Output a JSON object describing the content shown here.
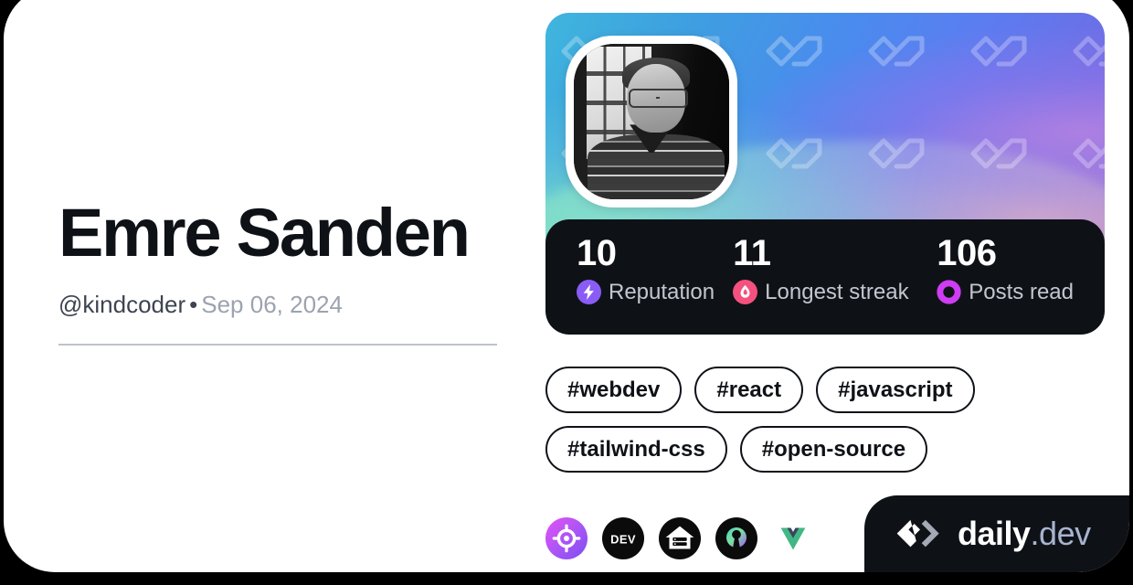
{
  "card": {
    "background_color": "#FFFFFF",
    "page_background": "#000000"
  },
  "profile": {
    "name": "Emre Sanden",
    "handle": "@kindcoder",
    "separator": "•",
    "joined_date": "Sep 06, 2024"
  },
  "cover": {
    "pattern_icon": "daily-dev-glyph-watermark",
    "gradient": [
      "#3FB6DD",
      "#4A8BEE",
      "#6C6FE6",
      "#7E63D8"
    ]
  },
  "avatar": {
    "alt": "Emre Sanden profile photo",
    "icon": "user-avatar"
  },
  "stats": [
    {
      "value": "10",
      "label": "Reputation",
      "icon": "reputation-bolt-icon",
      "color": "#8A5CF6"
    },
    {
      "value": "11",
      "label": "Longest streak",
      "icon": "streak-flame-icon",
      "color": "#F5517E"
    },
    {
      "value": "106",
      "label": "Posts read",
      "icon": "posts-read-ring-icon",
      "color": "#CE3DF3"
    }
  ],
  "tags": [
    "#webdev",
    "#react",
    "#javascript",
    "#tailwind-css",
    "#open-source"
  ],
  "sources": [
    {
      "icon": "crosshair-target-icon",
      "name": "target-source"
    },
    {
      "icon": "dev-to-icon",
      "name": "dev-to-source",
      "label": "DEV"
    },
    {
      "icon": "house-server-icon",
      "name": "selfhosted-source"
    },
    {
      "icon": "open-source-keyhole-icon",
      "name": "open-source-source"
    },
    {
      "icon": "vue-logo-icon",
      "name": "vue-source"
    }
  ],
  "branding": {
    "mark": "daily-dev-logo-mark",
    "name": "daily",
    "tld": ".dev"
  }
}
